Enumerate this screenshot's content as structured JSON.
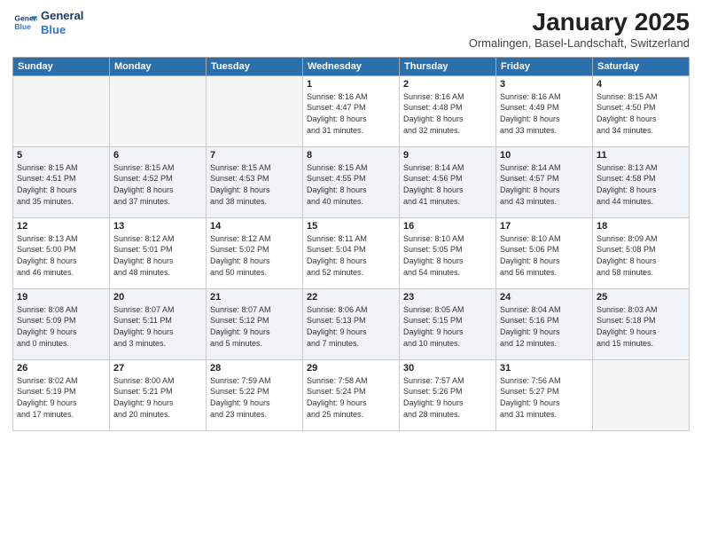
{
  "logo": {
    "line1": "General",
    "line2": "Blue"
  },
  "title": "January 2025",
  "subtitle": "Ormalingen, Basel-Landschaft, Switzerland",
  "days_of_week": [
    "Sunday",
    "Monday",
    "Tuesday",
    "Wednesday",
    "Thursday",
    "Friday",
    "Saturday"
  ],
  "weeks": [
    [
      {
        "day": "",
        "info": ""
      },
      {
        "day": "",
        "info": ""
      },
      {
        "day": "",
        "info": ""
      },
      {
        "day": "1",
        "info": "Sunrise: 8:16 AM\nSunset: 4:47 PM\nDaylight: 8 hours\nand 31 minutes."
      },
      {
        "day": "2",
        "info": "Sunrise: 8:16 AM\nSunset: 4:48 PM\nDaylight: 8 hours\nand 32 minutes."
      },
      {
        "day": "3",
        "info": "Sunrise: 8:16 AM\nSunset: 4:49 PM\nDaylight: 8 hours\nand 33 minutes."
      },
      {
        "day": "4",
        "info": "Sunrise: 8:15 AM\nSunset: 4:50 PM\nDaylight: 8 hours\nand 34 minutes."
      }
    ],
    [
      {
        "day": "5",
        "info": "Sunrise: 8:15 AM\nSunset: 4:51 PM\nDaylight: 8 hours\nand 35 minutes."
      },
      {
        "day": "6",
        "info": "Sunrise: 8:15 AM\nSunset: 4:52 PM\nDaylight: 8 hours\nand 37 minutes."
      },
      {
        "day": "7",
        "info": "Sunrise: 8:15 AM\nSunset: 4:53 PM\nDaylight: 8 hours\nand 38 minutes."
      },
      {
        "day": "8",
        "info": "Sunrise: 8:15 AM\nSunset: 4:55 PM\nDaylight: 8 hours\nand 40 minutes."
      },
      {
        "day": "9",
        "info": "Sunrise: 8:14 AM\nSunset: 4:56 PM\nDaylight: 8 hours\nand 41 minutes."
      },
      {
        "day": "10",
        "info": "Sunrise: 8:14 AM\nSunset: 4:57 PM\nDaylight: 8 hours\nand 43 minutes."
      },
      {
        "day": "11",
        "info": "Sunrise: 8:13 AM\nSunset: 4:58 PM\nDaylight: 8 hours\nand 44 minutes."
      }
    ],
    [
      {
        "day": "12",
        "info": "Sunrise: 8:13 AM\nSunset: 5:00 PM\nDaylight: 8 hours\nand 46 minutes."
      },
      {
        "day": "13",
        "info": "Sunrise: 8:12 AM\nSunset: 5:01 PM\nDaylight: 8 hours\nand 48 minutes."
      },
      {
        "day": "14",
        "info": "Sunrise: 8:12 AM\nSunset: 5:02 PM\nDaylight: 8 hours\nand 50 minutes."
      },
      {
        "day": "15",
        "info": "Sunrise: 8:11 AM\nSunset: 5:04 PM\nDaylight: 8 hours\nand 52 minutes."
      },
      {
        "day": "16",
        "info": "Sunrise: 8:10 AM\nSunset: 5:05 PM\nDaylight: 8 hours\nand 54 minutes."
      },
      {
        "day": "17",
        "info": "Sunrise: 8:10 AM\nSunset: 5:06 PM\nDaylight: 8 hours\nand 56 minutes."
      },
      {
        "day": "18",
        "info": "Sunrise: 8:09 AM\nSunset: 5:08 PM\nDaylight: 8 hours\nand 58 minutes."
      }
    ],
    [
      {
        "day": "19",
        "info": "Sunrise: 8:08 AM\nSunset: 5:09 PM\nDaylight: 9 hours\nand 0 minutes."
      },
      {
        "day": "20",
        "info": "Sunrise: 8:07 AM\nSunset: 5:11 PM\nDaylight: 9 hours\nand 3 minutes."
      },
      {
        "day": "21",
        "info": "Sunrise: 8:07 AM\nSunset: 5:12 PM\nDaylight: 9 hours\nand 5 minutes."
      },
      {
        "day": "22",
        "info": "Sunrise: 8:06 AM\nSunset: 5:13 PM\nDaylight: 9 hours\nand 7 minutes."
      },
      {
        "day": "23",
        "info": "Sunrise: 8:05 AM\nSunset: 5:15 PM\nDaylight: 9 hours\nand 10 minutes."
      },
      {
        "day": "24",
        "info": "Sunrise: 8:04 AM\nSunset: 5:16 PM\nDaylight: 9 hours\nand 12 minutes."
      },
      {
        "day": "25",
        "info": "Sunrise: 8:03 AM\nSunset: 5:18 PM\nDaylight: 9 hours\nand 15 minutes."
      }
    ],
    [
      {
        "day": "26",
        "info": "Sunrise: 8:02 AM\nSunset: 5:19 PM\nDaylight: 9 hours\nand 17 minutes."
      },
      {
        "day": "27",
        "info": "Sunrise: 8:00 AM\nSunset: 5:21 PM\nDaylight: 9 hours\nand 20 minutes."
      },
      {
        "day": "28",
        "info": "Sunrise: 7:59 AM\nSunset: 5:22 PM\nDaylight: 9 hours\nand 23 minutes."
      },
      {
        "day": "29",
        "info": "Sunrise: 7:58 AM\nSunset: 5:24 PM\nDaylight: 9 hours\nand 25 minutes."
      },
      {
        "day": "30",
        "info": "Sunrise: 7:57 AM\nSunset: 5:26 PM\nDaylight: 9 hours\nand 28 minutes."
      },
      {
        "day": "31",
        "info": "Sunrise: 7:56 AM\nSunset: 5:27 PM\nDaylight: 9 hours\nand 31 minutes."
      },
      {
        "day": "",
        "info": ""
      }
    ]
  ]
}
